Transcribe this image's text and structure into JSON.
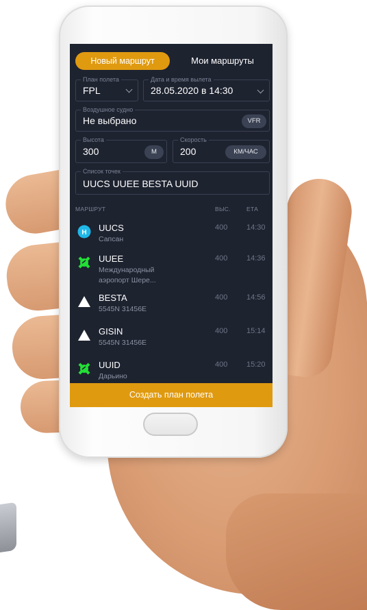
{
  "tabs": {
    "new_route": "Новый маршрут",
    "my_routes": "Мои маршруты"
  },
  "form": {
    "flight_plan": {
      "label": "План полета",
      "value": "FPL"
    },
    "departure": {
      "label": "Дата и время вылета",
      "value": "28.05.2020 в 14:30"
    },
    "aircraft": {
      "label": "Воздушное судно",
      "value": "Не выбрано",
      "badge": "VFR"
    },
    "altitude": {
      "label": "Высота",
      "value": "300",
      "unit": "М"
    },
    "speed": {
      "label": "Скорость",
      "value": "200",
      "unit": "КМ/ЧАС"
    },
    "points": {
      "label": "Список точек",
      "value": "UUCS UUEE BESTA UUID"
    }
  },
  "route_table": {
    "headers": {
      "route": "МАРШРУТ",
      "alt": "ВЫС.",
      "eta": "ЕТА"
    },
    "rows": [
      {
        "code": "UUCS",
        "sub": "Сапсан",
        "alt": "400",
        "eta": "14:30",
        "icon": "heliport-icon"
      },
      {
        "code": "UUEE",
        "sub": "Международный аэропорт Шере...",
        "alt": "400",
        "eta": "14:36",
        "icon": "airport-icon"
      },
      {
        "code": "BESTA",
        "sub": "5545N 31456E",
        "alt": "400",
        "eta": "14:56",
        "icon": "waypoint-icon"
      },
      {
        "code": "GISIN",
        "sub": "5545N 31456E",
        "alt": "400",
        "eta": "15:14",
        "icon": "waypoint-icon"
      },
      {
        "code": "UUID",
        "sub": "Дарьино",
        "alt": "400",
        "eta": "15:20",
        "icon": "airport-icon"
      }
    ]
  },
  "cta": {
    "label": "Создать план полета"
  },
  "colors": {
    "accent": "#e09a10",
    "screen_bg": "#1e2330",
    "heliport": "#1fb8e8",
    "airport": "#22e035"
  }
}
